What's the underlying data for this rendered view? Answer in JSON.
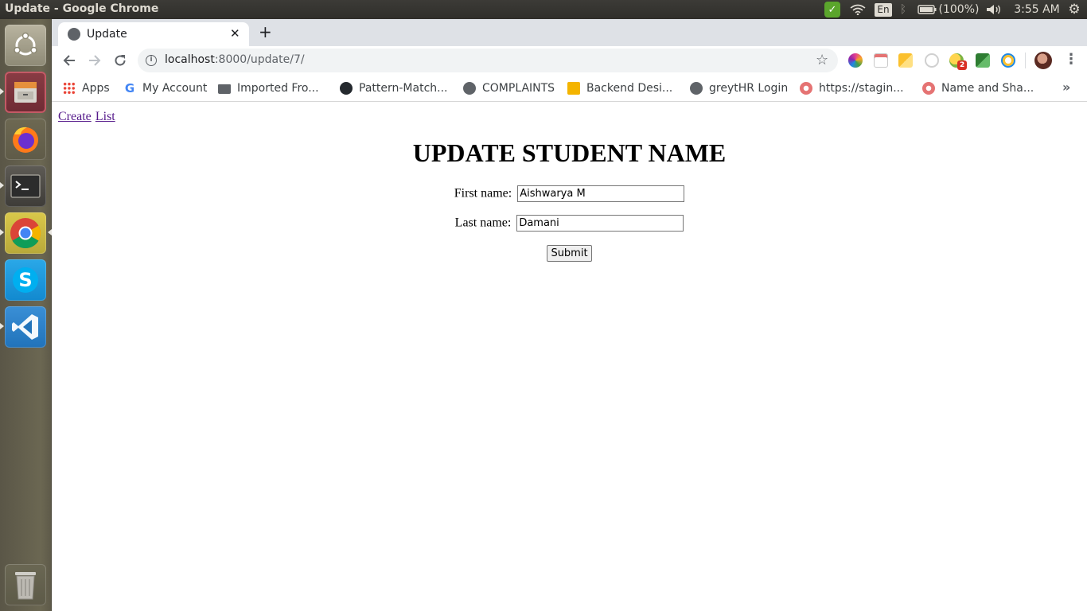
{
  "system_panel": {
    "window_title": "Update - Google Chrome",
    "language": "En",
    "battery": "(100%)",
    "clock": "3:55 AM"
  },
  "launcher": {
    "apps": [
      "ubuntu-dash-icon",
      "files-icon",
      "firefox-icon",
      "terminal-icon",
      "chrome-icon",
      "skype-icon",
      "vscode-icon",
      "trash-icon"
    ]
  },
  "browser": {
    "tab_title": "Update",
    "url_host": "localhost",
    "url_rest": ":8000/update/7/",
    "extension_badge": "2",
    "bookmarks": [
      {
        "label": "Apps",
        "icon": "apps-grid-icon"
      },
      {
        "label": "My Account",
        "icon": "google-icon"
      },
      {
        "label": "Imported Fro...",
        "icon": "folder-icon"
      },
      {
        "label": "Pattern-Match...",
        "icon": "github-icon"
      },
      {
        "label": "COMPLAINTS",
        "icon": "globe-icon"
      },
      {
        "label": "Backend Desi...",
        "icon": "slides-icon"
      },
      {
        "label": "greytHR Login",
        "icon": "globe-icon"
      },
      {
        "label": "https://stagin...",
        "icon": "gear-flower-icon"
      },
      {
        "label": "Name and Sha...",
        "icon": "gear-flower-icon"
      }
    ]
  },
  "page": {
    "nav": {
      "create": "Create",
      "list": "List"
    },
    "heading": "UPDATE STUDENT NAME",
    "form": {
      "first_name_label": "First name:",
      "first_name_value": "Aishwarya M",
      "last_name_label": "Last name:",
      "last_name_value": "Damani",
      "submit_label": "Submit"
    }
  }
}
